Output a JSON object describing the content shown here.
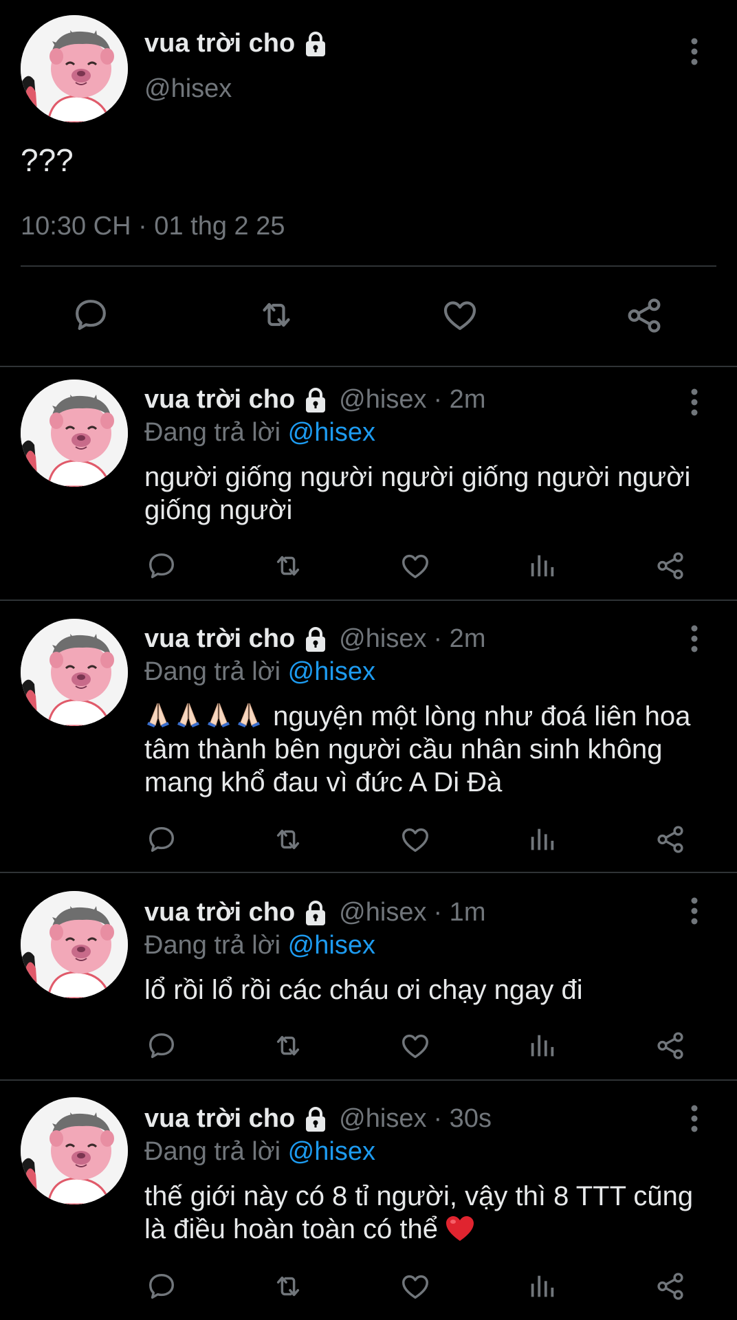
{
  "main_tweet": {
    "display_name": "vua trời cho",
    "handle": "@hisex",
    "text": "???",
    "timestamp": "10:30 CH · 01 thg 2 25",
    "icons": {
      "avatar": "pink-bear-avatar",
      "lock": "lock-icon",
      "more": "more-vertical-icon",
      "actions": [
        "reply-icon",
        "retweet-icon",
        "like-icon",
        "share-icon"
      ]
    }
  },
  "replies": [
    {
      "display_name": "vua trời cho",
      "handle": "@hisex",
      "time": "· 2m",
      "replying_label": "Đang trả lời",
      "replying_to": "@hisex",
      "text": "người giống người người giống người người giống người"
    },
    {
      "display_name": "vua trời cho",
      "handle": "@hisex",
      "time": "· 2m",
      "replying_label": "Đang trả lời",
      "replying_to": "@hisex",
      "text_emoji": "🙏🏻🙏🏻🙏🏻🙏🏻",
      "text": "nguyện một lòng như đoá liên hoa tâm thành bên người cầu nhân sinh không mang khổ đau vì đức A Di Đà"
    },
    {
      "display_name": "vua trời cho",
      "handle": "@hisex",
      "time": "· 1m",
      "replying_label": "Đang trả lời",
      "replying_to": "@hisex",
      "text": "lổ rồi lổ rồi các cháu ơi chạy ngay đi"
    },
    {
      "display_name": "vua trời cho",
      "handle": "@hisex",
      "time": "· 30s",
      "replying_label": "Đang trả lời",
      "replying_to": "@hisex",
      "text": "thế giới này có 8 tỉ người, vậy thì 8 TTT cũng là điều hoàn toàn có thể",
      "text_end_emoji": "❤️"
    }
  ],
  "colors": {
    "background": "#000000",
    "text": "#e7e9ea",
    "secondary": "#71767b",
    "mention": "#1d9bf0",
    "divider": "#2f3336"
  }
}
